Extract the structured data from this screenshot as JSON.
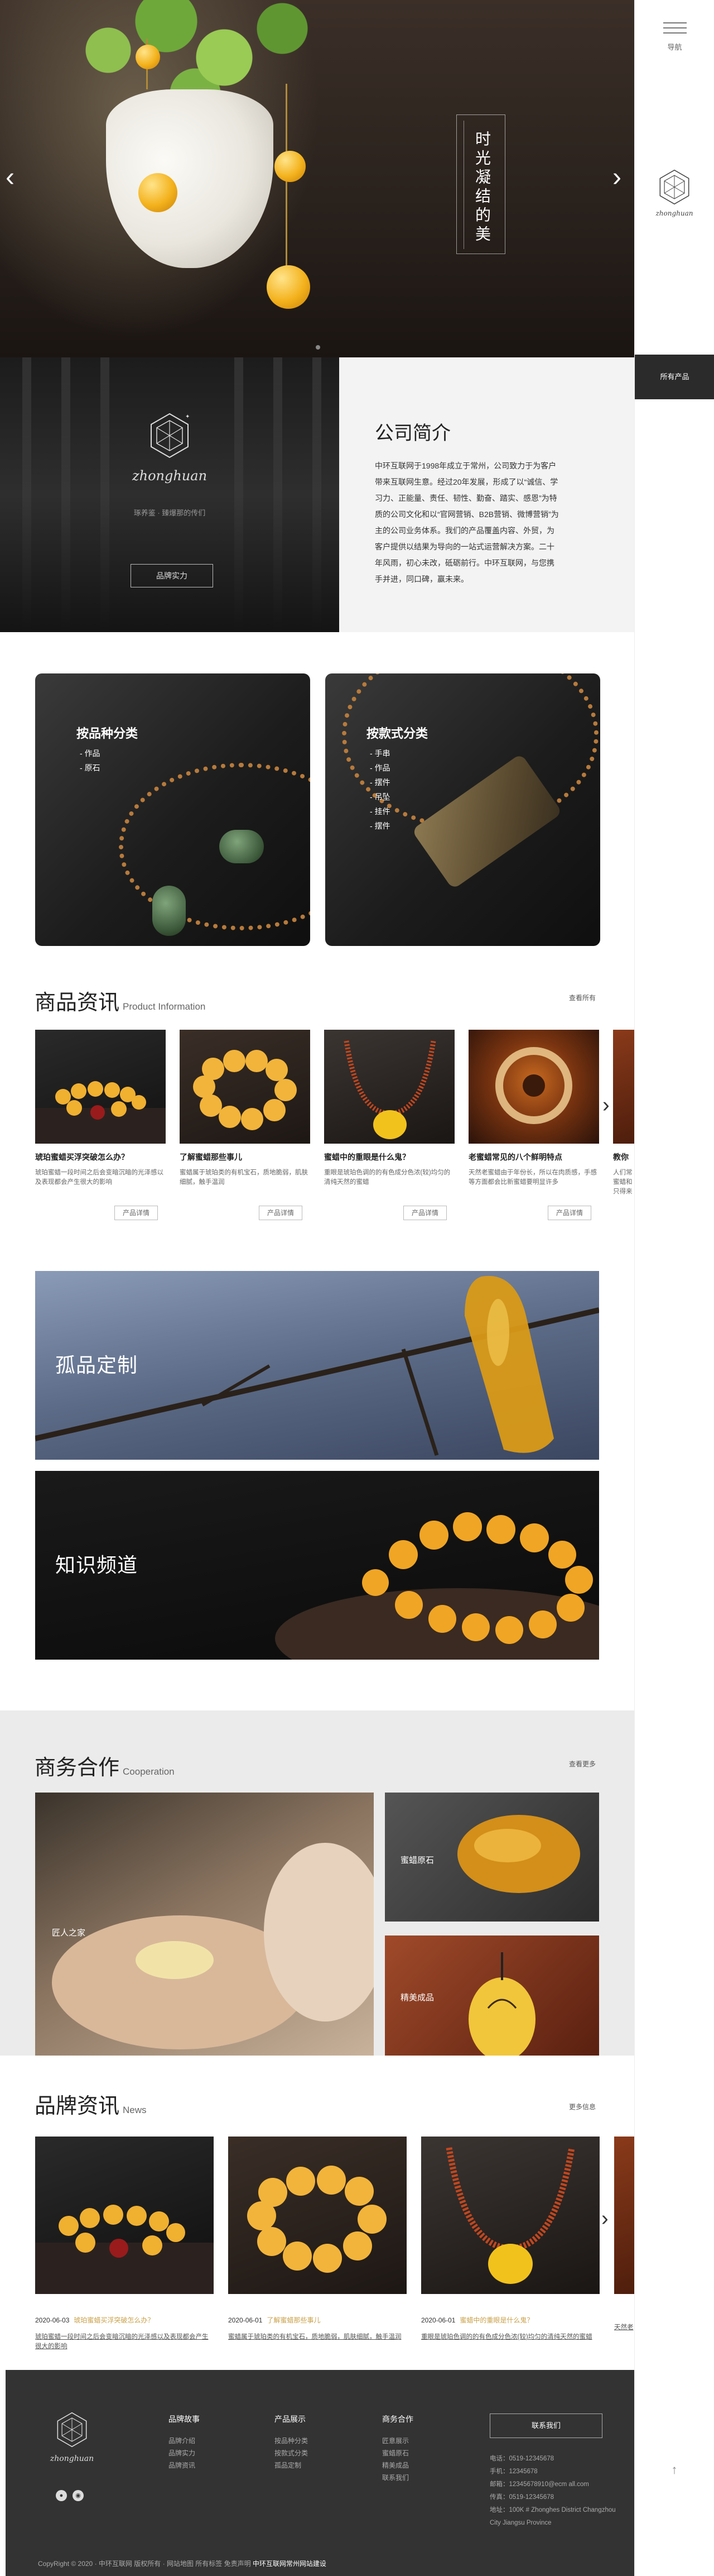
{
  "nav": {
    "label": "导航",
    "all_products": "所有产品"
  },
  "hero": {
    "poem": "时光凝结的美",
    "prev": "‹",
    "next": "›"
  },
  "intro": {
    "brand": "zhonghuan",
    "slogan": "琢养鉴 · 臻爆那的传们",
    "button": "品牌实力",
    "title": "公司简介",
    "text": "中环互联网于1998年成立于常州，公司致力于为客户带来互联网生意。经过20年发展，形成了以“诚信、学习力、正能量、责任、韧性、勤奋、踏实、感恩”为特质的公司文化和以“官网营销、B2B营销、微博营销”为主的公司业务体系。我们的产品覆盖内容、外贸，为客户提供以结果为导向的一站式运营解决方案。二十年风雨，初心未改，砥砺前行。中环互联网，与您携手并进，同口碑，赢未来。"
  },
  "categories": [
    {
      "title": "按品种分类",
      "items": [
        "作品",
        "原石"
      ]
    },
    {
      "title": "按款式分类",
      "items": [
        "手串",
        "作品",
        "摆件",
        "吊坠",
        "挂件",
        "摆件"
      ]
    }
  ],
  "products": {
    "title": "商品资讯",
    "subtitle": "Product Information",
    "more": "查看所有",
    "button": "产品详情",
    "items": [
      {
        "title": "琥珀蜜蜡买浮突破怎么办？",
        "desc": "琥珀蜜蜡一段时间之后会变暗沉暗的光泽感以及表现都会产生很大的影响"
      },
      {
        "title": "了解蜜蜡那些事儿",
        "desc": "蜜蜡属于琥珀类的有机宝石，质地脆弱，肌肤细腻，触手温润"
      },
      {
        "title": "蜜蜡中的重眼是什么鬼？",
        "desc": "重眼是琥珀色调的的有色成分色浓(较)均匀的清纯天然的蜜蜡",
        "desc_note": ""
      },
      {
        "title": "老蜜蜡常见的八个鲜明特点",
        "desc": "天然老蜜蜡由于年份长，所以在肉质感，手感等方面都会比新蜜蜡要明显许多"
      },
      {
        "title": "教你",
        "desc": "人们常蜜蜡和只得来"
      }
    ]
  },
  "banners": [
    {
      "title": "孤品定制"
    },
    {
      "title": "知识频道"
    }
  ],
  "cooperation": {
    "title": "商务合作",
    "subtitle": "Cooperation",
    "more": "查看更多",
    "tiles": [
      "匠人之家",
      "蜜蜡原石",
      "精美成品"
    ]
  },
  "news": {
    "title": "品牌资讯",
    "subtitle": "News",
    "more": "更多信息",
    "items": [
      {
        "date": "2020-06-03",
        "title": "琥珀蜜蜡买浮突破怎么办？",
        "desc": "琥珀蜜蜡一段时间之后会变暗沉暗的光泽感以及表现都会产生很大的影响"
      },
      {
        "date": "2020-06-01",
        "title": "了解蜜蜡那些事儿",
        "desc": "蜜蜡属于琥珀类的有机宝石，质地脆弱，肌肤细腻，触手温润"
      },
      {
        "date": "2020-06-01",
        "title": "蜜蜡中的重眼是什么鬼？",
        "desc": "重眼是琥珀色调的的有色成分色浓(较)均匀的清纯天然的蜜蜡"
      },
      {
        "date": "",
        "title": "",
        "desc": "天然老"
      }
    ]
  },
  "footer": {
    "brand": "zhonghuan",
    "cols": [
      {
        "title": "品牌故事",
        "links": [
          "品牌介绍",
          "品牌实力",
          "品牌资讯"
        ]
      },
      {
        "title": "产品展示",
        "links": [
          "按品种分类",
          "按款式分类",
          "孤品定制"
        ]
      },
      {
        "title": "商务合作",
        "links": [
          "匠意展示",
          "蜜蜡原石",
          "精美成品",
          "联系我们"
        ]
      }
    ],
    "contact_button": "联系我们",
    "info": [
      "电话：0519-12345678",
      "手机：12345678",
      "邮箱：12345678910@ecm all.com",
      "传真：0519-12345678",
      "地址：100K # Zhonghes District Changzhou City Jiangsu Province"
    ],
    "copyright": "CopyRight © 2020 · 中环互联网 版权所有 · 网站地图 所有标签 免责声明",
    "copyright_strong": "中环互联网常州网站建设"
  },
  "colors": {
    "accent": "#c9a14a",
    "dark": "#2b2b2b",
    "footer": "#333333",
    "amber": "#f3b21d"
  }
}
